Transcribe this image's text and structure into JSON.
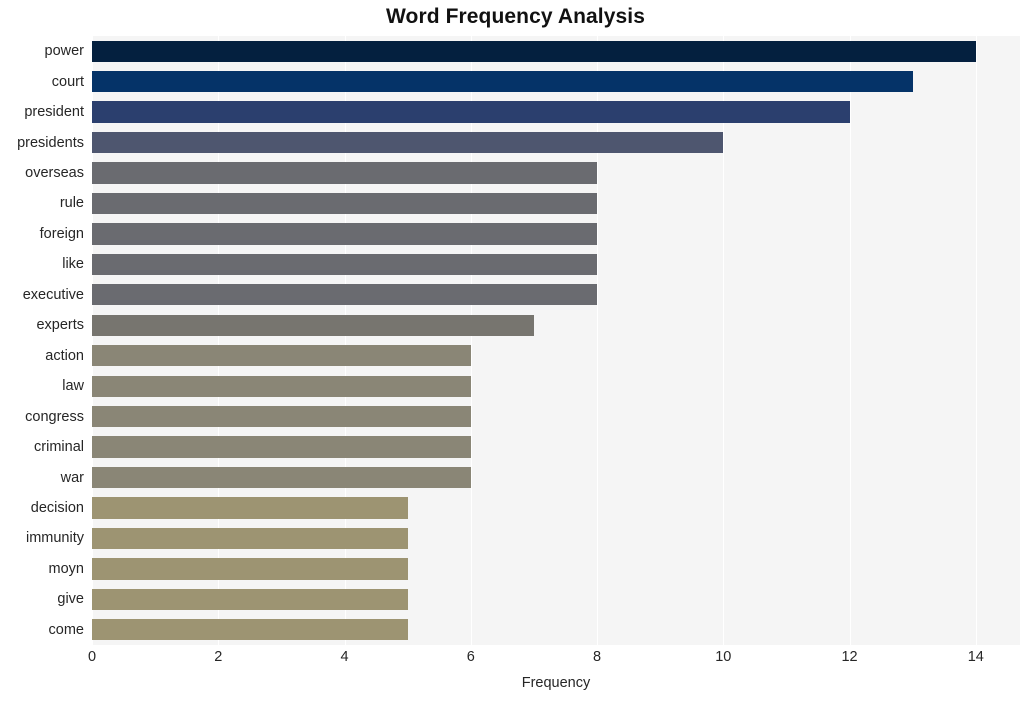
{
  "chart_data": {
    "type": "bar",
    "orientation": "horizontal",
    "title": "Word Frequency Analysis",
    "xlabel": "Frequency",
    "ylabel": "",
    "xlim": [
      0,
      14.7
    ],
    "xticks": [
      0,
      2,
      4,
      6,
      8,
      10,
      12,
      14
    ],
    "grid": "vertical-white-on-light-gray",
    "legend": "none",
    "categories": [
      "power",
      "court",
      "president",
      "presidents",
      "overseas",
      "rule",
      "foreign",
      "like",
      "executive",
      "experts",
      "action",
      "law",
      "congress",
      "criminal",
      "war",
      "decision",
      "immunity",
      "moyn",
      "give",
      "come"
    ],
    "values": [
      14,
      13,
      12,
      10,
      8,
      8,
      8,
      8,
      8,
      7,
      6,
      6,
      6,
      6,
      6,
      5,
      5,
      5,
      5,
      5
    ],
    "bar_colors": [
      "#04203f",
      "#053368",
      "#2b3f6e",
      "#4e566f",
      "#6a6b70",
      "#6a6b70",
      "#6a6b70",
      "#6a6b70",
      "#6a6b70",
      "#77756f",
      "#8a8676",
      "#8a8676",
      "#8a8676",
      "#8a8676",
      "#8a8676",
      "#9d9472",
      "#9d9472",
      "#9d9472",
      "#9d9472",
      "#9d9472"
    ]
  },
  "figure": {
    "background_color": "#ffffff",
    "plot_background_color": "#f5f5f5",
    "gridline_color": "#ffffff",
    "text_color": "#262626"
  }
}
